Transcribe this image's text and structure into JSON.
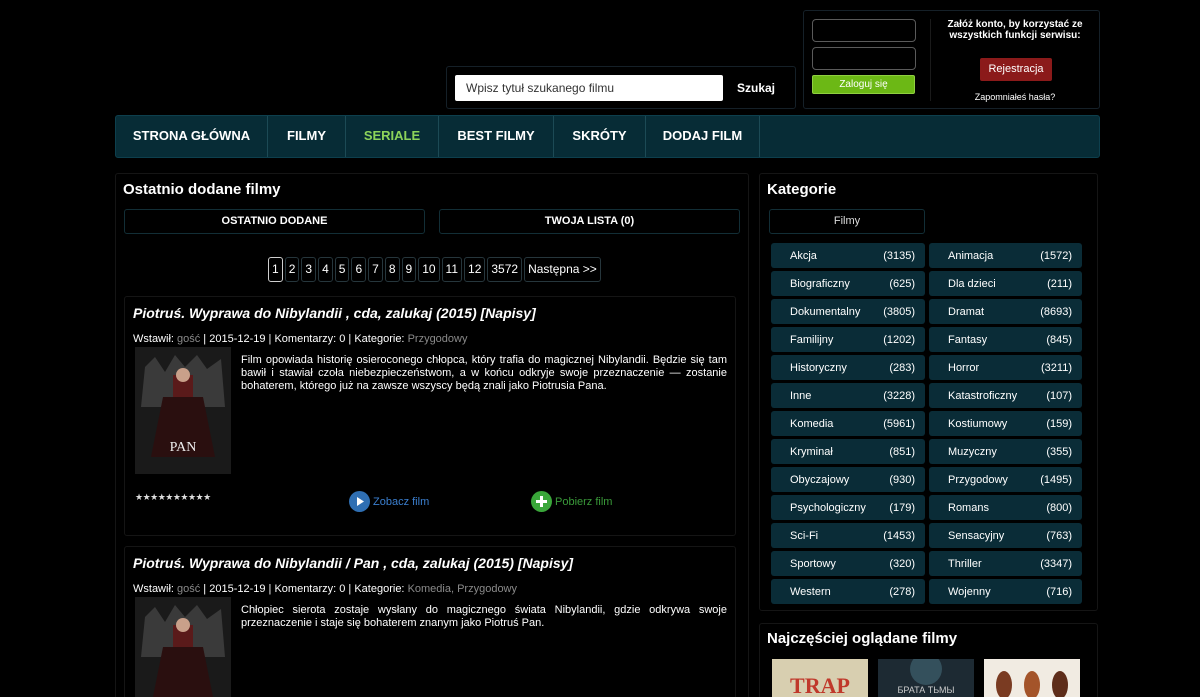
{
  "search": {
    "placeholder": "Wpisz tytuł szukanego filmu",
    "button": "Szukaj"
  },
  "login": {
    "button": "Zaloguj się",
    "register_info": "Załóż konto, by korzystać ze wszystkich funkcji serwisu:",
    "register_button": "Rejestracja",
    "forgot": "Zapomniałeś hasła?"
  },
  "nav": [
    {
      "label": "STRONA GŁÓWNA",
      "active": false
    },
    {
      "label": "FILMY",
      "active": false
    },
    {
      "label": "SERIALE",
      "active": true
    },
    {
      "label": "BEST FILMY",
      "active": false
    },
    {
      "label": "SKRÓTY",
      "active": false
    },
    {
      "label": "DODAJ FILM",
      "active": false
    }
  ],
  "main": {
    "title": "Ostatnio dodane filmy",
    "tabs": [
      "OSTATNIO DODANE",
      "TWOJA LISTA (0)"
    ],
    "pagination": [
      "1",
      "2",
      "3",
      "4",
      "5",
      "6",
      "7",
      "8",
      "9",
      "10",
      "11",
      "12",
      "3572",
      "Następna >>"
    ],
    "current_page": "1"
  },
  "movies": [
    {
      "title": "Piotruś. Wyprawa do Nibylandii , cda, zalukaj (2015) [Napisy]",
      "meta_prefix": "Wstawił: ",
      "user": "gość",
      "meta_middle": " | 2015-12-19 | Komentarzy: 0 | Kategorie: ",
      "categories": "Przygodowy",
      "description": "Film opowiada historię osieroconego chłopca, który trafia do magicznej Nibylandii. Będzie się tam bawił i stawiał czoła niebezpieczeństwom, a w końcu odkryje swoje przeznaczenie — zostanie bohaterem, którego już na zawsze wszyscy będą znali jako Piotrusia Pana.",
      "poster_text": "PAN",
      "stars": "★★★★★★★★★★",
      "watch": "Zobacz film",
      "download": "Pobierz film"
    },
    {
      "title": "Piotruś. Wyprawa do Nibylandii / Pan , cda, zalukaj (2015) [Napisy]",
      "meta_prefix": "Wstawił: ",
      "user": "gość",
      "meta_middle": " | 2015-12-19 | Komentarzy: 0 | Kategorie: ",
      "categories": "Komedia, Przygodowy",
      "description": "Chłopiec sierota zostaje wysłany do magicznego świata Nibylandii, gdzie odkrywa swoje przeznaczenie i staje się bohaterem znanym jako Piotruś Pan."
    }
  ],
  "sidebar": {
    "title": "Kategorie",
    "filter_tab": "Filmy",
    "categories": [
      {
        "name": "Akcja",
        "count": "(3135)"
      },
      {
        "name": "Animacja",
        "count": "(1572)"
      },
      {
        "name": "Biograficzny",
        "count": "(625)"
      },
      {
        "name": "Dla dzieci",
        "count": "(211)"
      },
      {
        "name": "Dokumentalny",
        "count": "(3805)"
      },
      {
        "name": "Dramat",
        "count": "(8693)"
      },
      {
        "name": "Familijny",
        "count": "(1202)"
      },
      {
        "name": "Fantasy",
        "count": "(845)"
      },
      {
        "name": "Historyczny",
        "count": "(283)"
      },
      {
        "name": "Horror",
        "count": "(3211)"
      },
      {
        "name": "Inne",
        "count": "(3228)"
      },
      {
        "name": "Katastroficzny",
        "count": "(107)"
      },
      {
        "name": "Komedia",
        "count": "(5961)"
      },
      {
        "name": "Kostiumowy",
        "count": "(159)"
      },
      {
        "name": "Kryminał",
        "count": "(851)"
      },
      {
        "name": "Muzyczny",
        "count": "(355)"
      },
      {
        "name": "Obyczajowy",
        "count": "(930)"
      },
      {
        "name": "Przygodowy",
        "count": "(1495)"
      },
      {
        "name": "Psychologiczny",
        "count": "(179)"
      },
      {
        "name": "Romans",
        "count": "(800)"
      },
      {
        "name": "Sci-Fi",
        "count": "(1453)"
      },
      {
        "name": "Sensacyjny",
        "count": "(763)"
      },
      {
        "name": "Sportowy",
        "count": "(320)"
      },
      {
        "name": "Thriller",
        "count": "(3347)"
      },
      {
        "name": "Western",
        "count": "(278)"
      },
      {
        "name": "Wojenny",
        "count": "(716)"
      }
    ],
    "popular_title": "Najczęściej oglądane filmy",
    "popular_thumbs": [
      {
        "text": "TRAP"
      },
      {
        "text": "БРАТА ТЬМЫ"
      },
      {
        "text": ""
      }
    ]
  },
  "colors": {
    "accent_green": "#8cd35a",
    "nav_bg": "#072c36",
    "login_green": "#6cb815",
    "register_red": "#8b1a1a",
    "link_blue": "#3b7fcf",
    "link_green": "#3a9a3a"
  }
}
